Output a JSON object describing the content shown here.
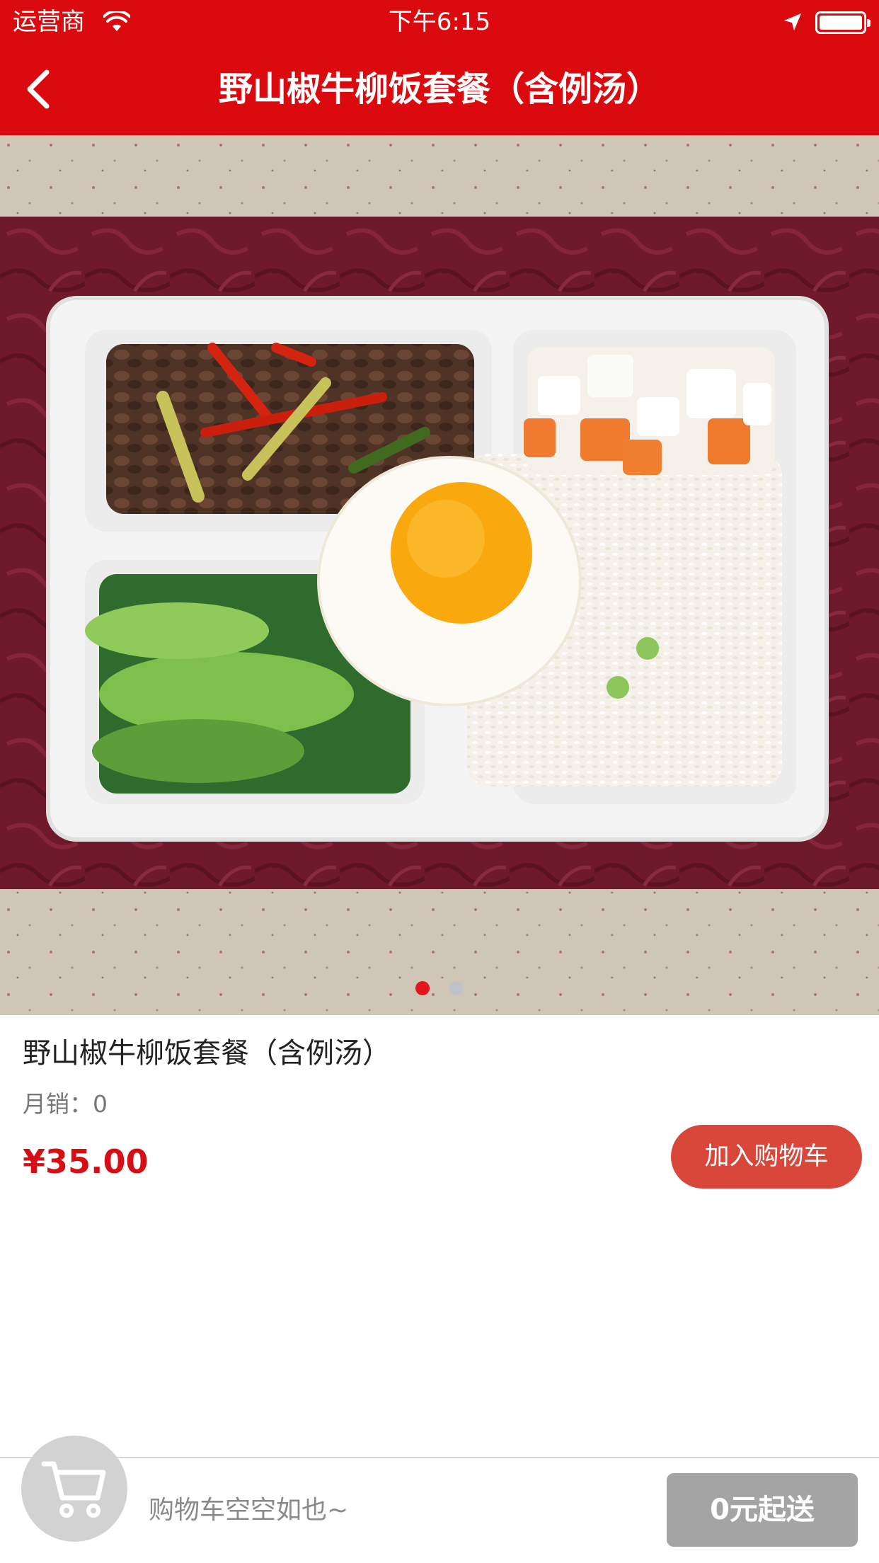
{
  "status_bar": {
    "carrier": "运营商",
    "time": "下午6:15",
    "icons": [
      "wifi-icon",
      "location-icon",
      "battery-icon"
    ]
  },
  "nav": {
    "title": "野山椒牛柳饭套餐（含例汤）",
    "back_icon": "chevron-left-icon"
  },
  "carousel": {
    "slide_count": 2,
    "active_index": 0
  },
  "product": {
    "name": "野山椒牛柳饭套餐（含例汤）",
    "sales": "月销：0",
    "price": "¥35.00",
    "add_to_cart": "加入购物车"
  },
  "cart": {
    "icon": "cart-icon",
    "empty_text": "购物车空空如也~",
    "min_order": "0元起送"
  },
  "colors": {
    "brand_red": "#db0a0e",
    "price_red": "#d60f14",
    "button_red": "#d9473b",
    "disabled_gray": "#a4a4a4"
  }
}
